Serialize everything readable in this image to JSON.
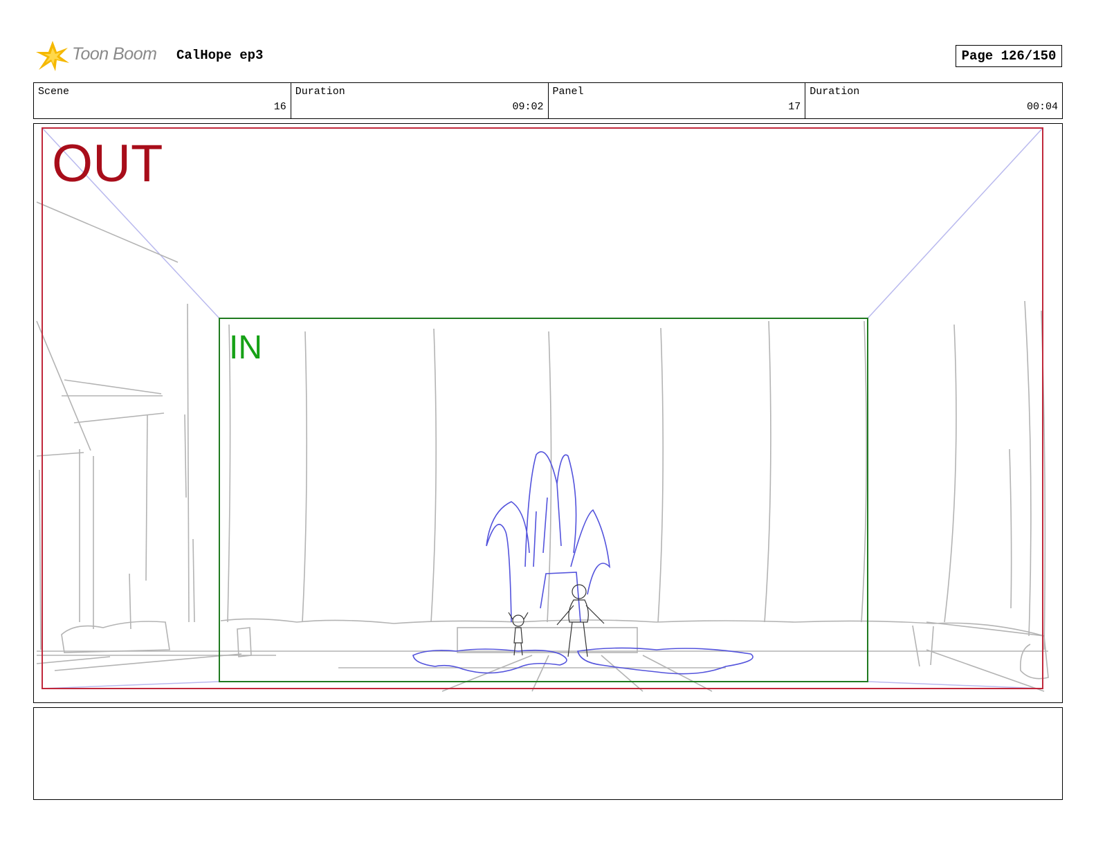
{
  "header": {
    "logo_text": "Toon Boom",
    "project_title": "CalHope ep3",
    "page_label": "Page 126/150"
  },
  "info": {
    "scene_label": "Scene",
    "scene_value": "16",
    "scene_duration_label": "Duration",
    "scene_duration_value": "09:02",
    "panel_label": "Panel",
    "panel_value": "17",
    "panel_duration_label": "Duration",
    "panel_duration_value": "00:04"
  },
  "panel": {
    "out_label": "OUT",
    "in_label": "IN"
  },
  "colors": {
    "out_frame": "#c0273a",
    "in_frame": "#1f7a1f",
    "sketch_gray": "#b3b3b3",
    "sketch_blue": "#5050e0"
  },
  "notes": {
    "text": ""
  }
}
